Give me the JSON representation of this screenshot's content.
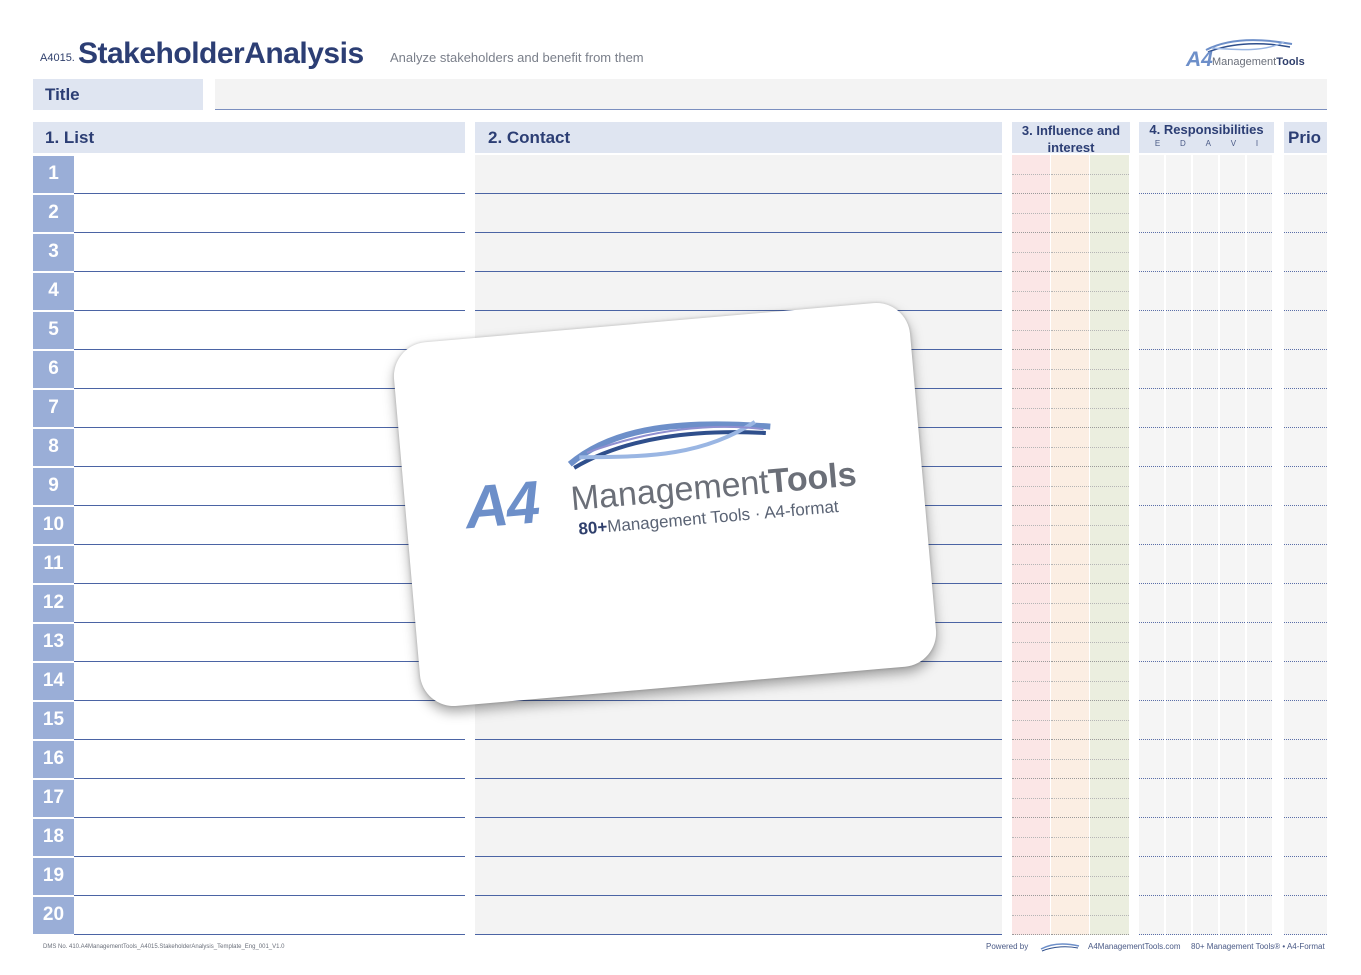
{
  "header": {
    "code": "A4015.",
    "title": "StakeholderAnalysis",
    "subtitle": "Analyze stakeholders and benefit from them",
    "logo_a4": "A4",
    "logo_management": "Management",
    "logo_tools": "Tools"
  },
  "title_row": {
    "label": "Title",
    "value": ""
  },
  "columns": {
    "list": "1. List",
    "contact": "2. Contact",
    "influence": "3. Influence and interest",
    "responsibilities": "4. Responsibilities",
    "responsibility_letters": [
      "E",
      "D",
      "A",
      "V",
      "I"
    ],
    "prio": "Prio"
  },
  "rows": [
    "1",
    "2",
    "3",
    "4",
    "5",
    "6",
    "7",
    "8",
    "9",
    "10",
    "11",
    "12",
    "13",
    "14",
    "15",
    "16",
    "17",
    "18",
    "19",
    "20"
  ],
  "colors": {
    "accent": "#2c3e74",
    "header_bg": "#dfe5f1",
    "row_number_bg": "#9aaed7",
    "influence_col_1": "#fbe6e6",
    "influence_col_2": "#fbeee3",
    "influence_col_3": "#ebeedf"
  },
  "card": {
    "a4": "A4",
    "management": "Management",
    "tools": "Tools",
    "tagline_bold": "80+",
    "tagline_rest": "Management Tools · A4-format"
  },
  "footer": {
    "dms": "DMS No. 410.A4ManagementTools_A4015.StakeholderAnalysis_Template_Eng_001_V1.0",
    "powered_by": "Powered by",
    "site": "A4ManagementTools.com",
    "tagline": "80+ Management Tools® • A4-Format"
  }
}
